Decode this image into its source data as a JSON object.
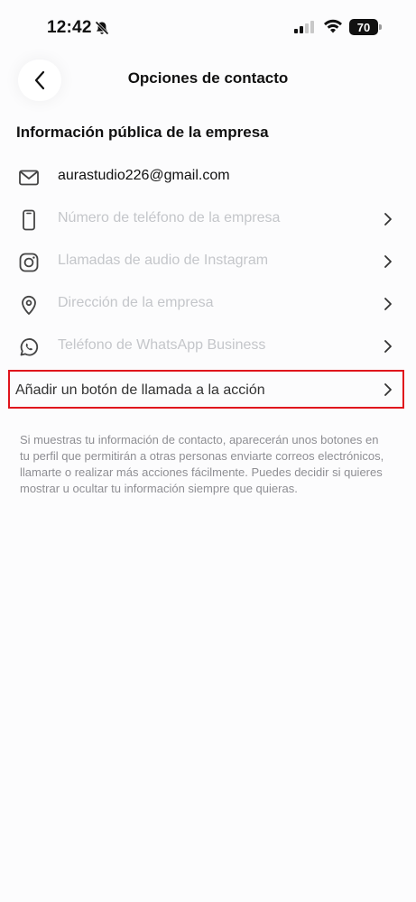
{
  "status_bar": {
    "time": "12:42",
    "battery": "70"
  },
  "nav": {
    "title": "Opciones de contacto"
  },
  "section": {
    "title": "Información pública de la empresa"
  },
  "rows": [
    {
      "icon": "mail-icon",
      "label": "aurastudio226@gmail.com"
    },
    {
      "icon": "phone-icon",
      "label": "Número de teléfono de la empresa"
    },
    {
      "icon": "instagram-icon",
      "label": "Llamadas de audio de Instagram"
    },
    {
      "icon": "location-pin-icon",
      "label": "Dirección de la empresa"
    },
    {
      "icon": "whatsapp-icon",
      "label": "Teléfono de WhatsApp Business"
    }
  ],
  "cta": {
    "label": "Añadir un botón de llamada a la acción"
  },
  "help_text": "Si muestras tu información de contacto, aparecerán unos botones en tu perfil que permitirán a otras personas enviarte correos electrónicos, llamarte o realizar más acciones fácilmente. Puedes decidir si quieres mostrar u ocultar tu información siempre que quieras.",
  "colors": {
    "highlight": "#e0141c",
    "placeholder_text": "#c4c6ca",
    "help_text": "#8e8e93"
  }
}
